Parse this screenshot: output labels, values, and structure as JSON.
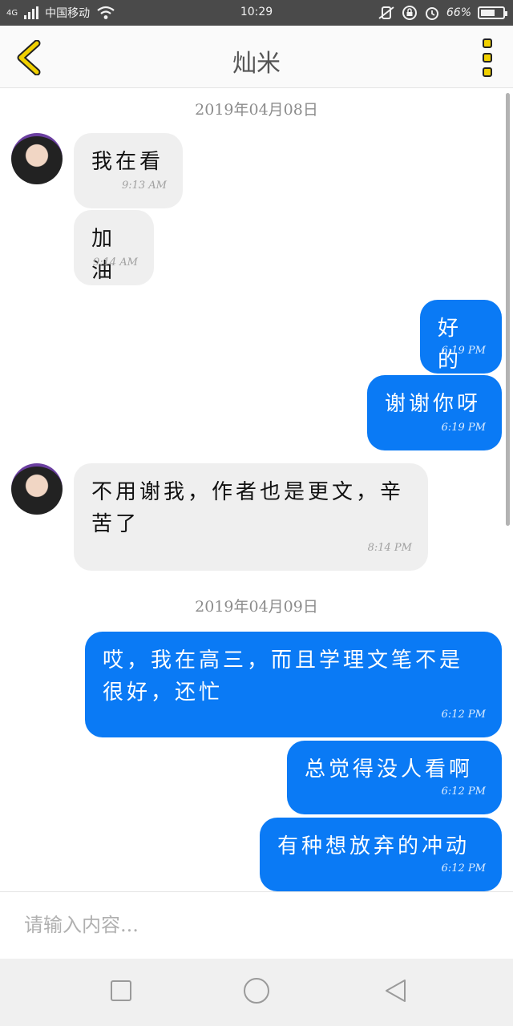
{
  "status_bar": {
    "network": "4G",
    "carrier": "中国移动",
    "time": "10:29",
    "battery": "66%",
    "battery_level": 0.66
  },
  "header": {
    "title": "灿米"
  },
  "chat": {
    "messages": [
      {
        "type": "date",
        "text": "2019年04月08日"
      },
      {
        "type": "in",
        "text": "我在看",
        "time": "9:13 AM"
      },
      {
        "type": "in",
        "text": "加油",
        "time": "9:14 AM"
      },
      {
        "type": "out",
        "text": "好的",
        "time": "6:19 PM"
      },
      {
        "type": "out",
        "text": "谢谢你呀",
        "time": "6:19 PM"
      },
      {
        "type": "in",
        "text": "不用谢我，作者也是更文，辛苦了",
        "time": "8:14 PM"
      },
      {
        "type": "date",
        "text": "2019年04月09日"
      },
      {
        "type": "out",
        "text": "哎，我在高三，而且学理文笔不是很好，还忙",
        "time": "6:12 PM"
      },
      {
        "type": "out",
        "text": "总觉得没人看啊",
        "time": "6:12 PM"
      },
      {
        "type": "out",
        "text": "有种想放弃的冲动",
        "time": "6:12 PM"
      }
    ]
  },
  "input": {
    "placeholder": "请输入内容..."
  },
  "colors": {
    "outgoing_bubble": "#0a7af5",
    "incoming_bubble": "#efefef",
    "accent_icons": "#f0d000"
  }
}
